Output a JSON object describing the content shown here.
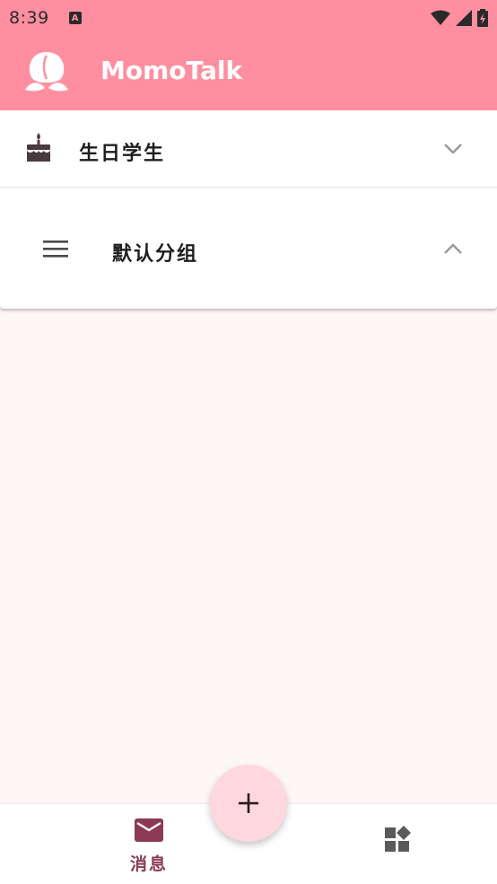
{
  "status": {
    "time": "8:39",
    "notification_glyph": "A"
  },
  "app": {
    "title": "MomoTalk",
    "logo_icon": "peach-logo-icon"
  },
  "groups": [
    {
      "label": "生日学生",
      "icon": "cake-icon",
      "expanded": false
    },
    {
      "label": "默认分组",
      "icon": "menu-icon",
      "expanded": true
    }
  ],
  "bottom_nav": {
    "messages_label": "消息",
    "messages_icon": "mail-icon",
    "widgets_icon": "widgets-icon"
  },
  "fab": {
    "icon": "plus-icon"
  },
  "colors": {
    "appbar": "#ff8fa0",
    "background": "#fdf7f7",
    "nav_active": "#8a3a55",
    "fab": "#ffd7de"
  }
}
